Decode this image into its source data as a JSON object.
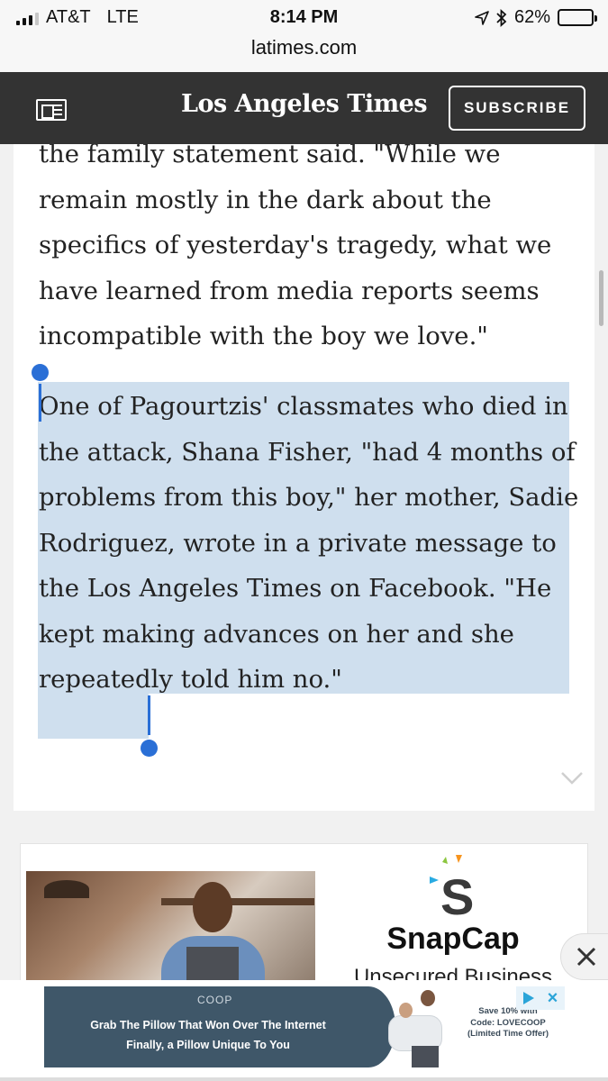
{
  "status_bar": {
    "carrier": "AT&T",
    "network": "LTE",
    "time": "8:14 PM",
    "battery": "62%",
    "battery_level": 0.62,
    "url": "latimes.com"
  },
  "header": {
    "logo_text": "Los Angeles Times",
    "subscribe_label": "SUBSCRIBE"
  },
  "article": {
    "paragraph_1": "the family statement said. \"While we remain mostly in the dark about the specifics of yesterday's tragedy, what we have learned from media reports seems incompatible with the boy we love.\"",
    "paragraph_2": "One of Pagourtzis' classmates who died in the attack, Shana Fisher, \"had 4 months of problems from this boy,\" her mother, Sadie Rodriguez, wrote in a private message to the Los Angeles Times on Facebook. \"He kept making advances on her and she repeatedly told him no.\""
  },
  "ad": {
    "brand": "SnapCap",
    "subtitle": "Unsecured Business"
  },
  "banner": {
    "brand": "COOP",
    "line1": "Grab The Pillow That Won Over The Internet",
    "line2": "Finally, a Pillow Unique To You",
    "offer_1": "Save 10% with",
    "offer_2": "Code: LOVECOOP",
    "offer_3": "(Limited Time Offer)"
  },
  "colors": {
    "header_bg": "#333333",
    "selection": "#cfdfee",
    "selection_handle": "#2a6fd6",
    "banner_blue": "#3f5769"
  }
}
